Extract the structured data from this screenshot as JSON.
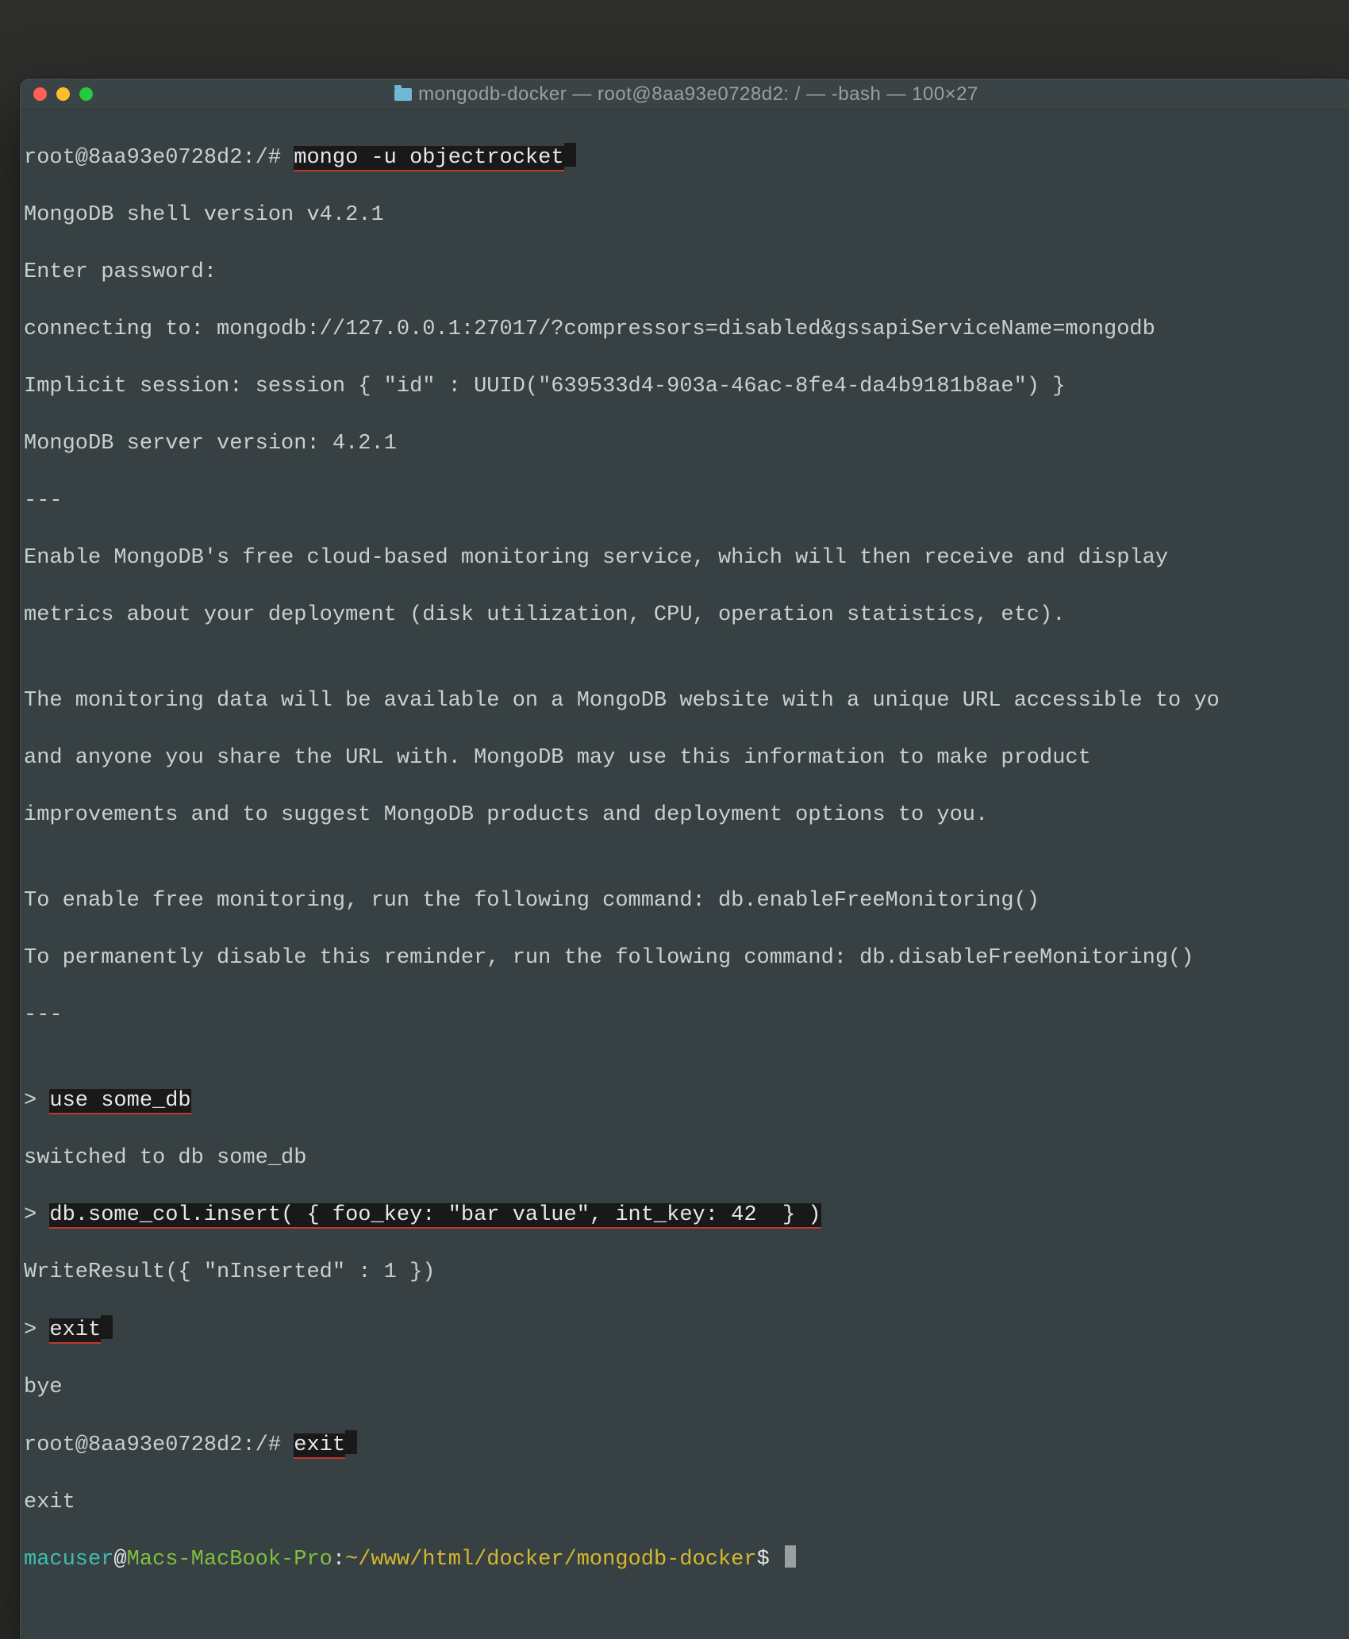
{
  "title": "mongodb-docker — root@8aa93e0728d2: / — -bash — 100×27",
  "term": {
    "prompt_root": "root@8aa93e0728d2:/#",
    "cmd1": "mongo -u objectrocket",
    "line2": "MongoDB shell version v4.2.1",
    "line3": "Enter password:",
    "line4": "connecting to: mongodb://127.0.0.1:27017/?compressors=disabled&gssapiServiceName=mongodb",
    "line5": "Implicit session: session { \"id\" : UUID(\"639533d4-903a-46ac-8fe4-da4b9181b8ae\") }",
    "line6": "MongoDB server version: 4.2.1",
    "line7": "---",
    "line8": "Enable MongoDB's free cloud-based monitoring service, which will then receive and display",
    "line9": "metrics about your deployment (disk utilization, CPU, operation statistics, etc).",
    "line10": "",
    "line11": "The monitoring data will be available on a MongoDB website with a unique URL accessible to yo",
    "line12": "and anyone you share the URL with. MongoDB may use this information to make product",
    "line13": "improvements and to suggest MongoDB products and deployment options to you.",
    "line14": "",
    "line15": "To enable free monitoring, run the following command: db.enableFreeMonitoring()",
    "line16": "To permanently disable this reminder, run the following command: db.disableFreeMonitoring()",
    "line17": "---",
    "line18": "",
    "p1": ">",
    "cmd2": "use some_db",
    "line20": "switched to db some_db",
    "cmd3": "db.some_col.insert( { foo_key: \"bar value\", int_key: 42  } )",
    "line22": "WriteResult({ \"nInserted\" : 1 })",
    "cmd4": "exit",
    "line24": "bye",
    "cmd5": "exit",
    "line26": "exit",
    "final_user": "macuser",
    "final_host": "Macs-MacBook-Pro",
    "final_path": "~/www/html/docker/mongodb-docker",
    "final_dollar": "$"
  }
}
